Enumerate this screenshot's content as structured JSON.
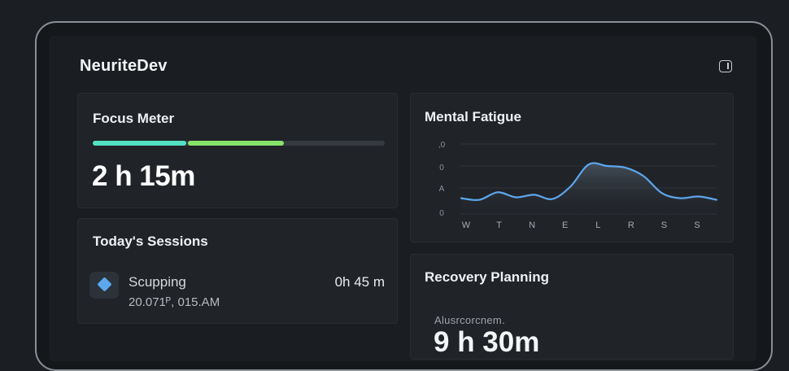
{
  "app": {
    "title": "NeuriteDev",
    "window_icon": "window-toggle-icon"
  },
  "focus_meter": {
    "title": "Focus Meter",
    "value": "2 h 15m",
    "segments": [
      {
        "color": "#54e1c3",
        "fraction": 0.32
      },
      {
        "color": "#86e36a",
        "fraction": 0.33
      }
    ]
  },
  "sessions": {
    "title": "Today's Sessions",
    "items": [
      {
        "icon": "gem-icon",
        "name": "Scupping",
        "time": "20.071ᴾ, 015.AM",
        "duration": "0h 45 m"
      }
    ]
  },
  "fatigue": {
    "title": "Mental Fatigue"
  },
  "recovery": {
    "title": "Recovery Planning",
    "subtitle": "Alusrcorcnem.",
    "value": "9 h 30m"
  },
  "colors": {
    "accent_line": "#5ca7ee",
    "focus_teal": "#54e1c3",
    "focus_green": "#86e36a"
  },
  "chart_data": {
    "type": "area",
    "title": "Mental Fatigue",
    "categories": [
      "W",
      "T",
      "N",
      "E",
      "L",
      "R",
      "S",
      "S"
    ],
    "y_tick_labels": [
      ",0",
      "0",
      "A",
      "0"
    ],
    "series": [
      {
        "values": [
          0.36,
          0.34,
          0.43,
          0.37,
          0.4,
          0.35,
          0.5,
          0.76,
          0.74,
          0.72,
          0.62,
          0.42,
          0.36,
          0.38,
          0.34
        ]
      }
    ],
    "ylim": [
      0,
      1
    ],
    "grid": true
  }
}
